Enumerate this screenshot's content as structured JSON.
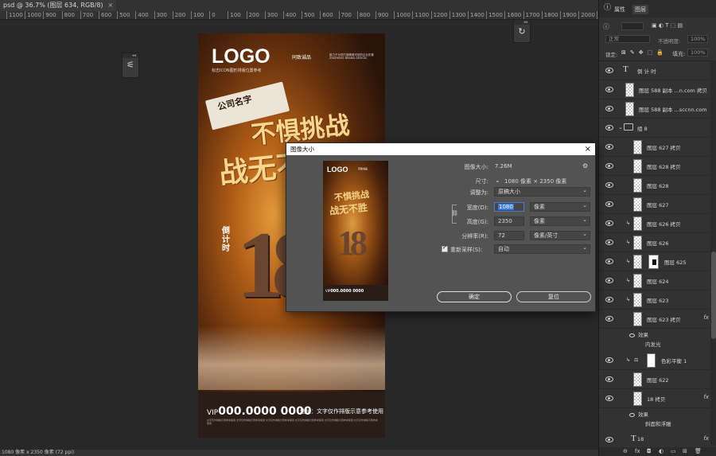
{
  "document_tab": {
    "title": "psd @ 36.7% (图层 634, RGB/8)",
    "close": "×"
  },
  "ruler_ticks": [
    "1100",
    "1000",
    "900",
    "800",
    "700",
    "600",
    "500",
    "400",
    "300",
    "200",
    "100",
    "0",
    "100",
    "200",
    "300",
    "400",
    "500",
    "600",
    "700",
    "800",
    "900",
    "1000",
    "1100",
    "1200",
    "1300",
    "1400",
    "1500",
    "1600",
    "1700",
    "1800",
    "1900",
    "2000",
    "2100"
  ],
  "status_bar": "1080 像素 x 2350 像素 (72 ppi)",
  "poster": {
    "logo": "LOGO",
    "logo_sub": "标志ICON图形排版位置参考",
    "brand": "同致诚品",
    "brand_small": "致力于为您打造精美可信的企业形象 ZHIZHENG BRAND DESIGN",
    "flag_text": "公司名字",
    "slogan_line1": "不惧挑战",
    "slogan_line2": "战无不胜",
    "countdown_label": "倒计时",
    "big_number": "18",
    "vip_prefix": "VIP",
    "vip_number": "000.0000 0000",
    "address": "地址：文字仅作排版示意参考使用",
    "fine_print": "文字仅作排版示意参考使用 文字仅作排版示意参考使用 文字仅作排版示意参考使用 文字仅作排版示意参考使用 文字仅作排版示意参考使用 文字仅作排版示意参考使用"
  },
  "panels": {
    "tabs": {
      "adjustments": "属性",
      "layers": "图层"
    },
    "blend_mode": "正常",
    "opacity_label": "不透明度:",
    "opacity_value": "100%",
    "lock_label": "锁定:",
    "fill_label": "填充:",
    "fill_value": "100%",
    "layers": [
      {
        "type": "text",
        "name": "倒 计 时"
      },
      {
        "type": "pixel",
        "name": "图层 588 副本 ...n.com 拷贝"
      },
      {
        "type": "pixel",
        "name": "图层 588 副本 ...sccnn.com"
      },
      {
        "type": "group",
        "name": "组 8"
      },
      {
        "type": "pixel",
        "name": "图层 627 拷贝"
      },
      {
        "type": "pixel",
        "name": "图层 628 拷贝"
      },
      {
        "type": "pixel",
        "name": "图层 628"
      },
      {
        "type": "pixel",
        "name": "图层 627"
      },
      {
        "type": "pixel",
        "name": "图层 626 拷贝"
      },
      {
        "type": "pixel",
        "name": "图层 626"
      },
      {
        "type": "masked",
        "name": "图层 625"
      },
      {
        "type": "pixel",
        "name": "图层 624"
      },
      {
        "type": "pixel",
        "name": "图层 623"
      },
      {
        "type": "pixel",
        "name": "图层 623 拷贝",
        "fx": "fx"
      },
      {
        "type": "adjust",
        "name": "色彩平衡 1"
      },
      {
        "type": "pixel",
        "name": "图层 622"
      },
      {
        "type": "pixel",
        "name": "18 拷贝",
        "fx": "fx"
      },
      {
        "type": "text",
        "name": "18",
        "fx": "fx"
      }
    ],
    "effects_label": "效果",
    "effect_inner_glow": "内发光",
    "effect_bevel": "斜面和浮雕",
    "bottom_icons": [
      "link-icon",
      "fx-icon",
      "mask-icon",
      "adjust-icon",
      "folder-icon",
      "new-layer-icon",
      "trash-icon"
    ],
    "bottom_glyphs": [
      "⊖",
      "fx",
      "◘",
      "◐",
      "▭",
      "⊞",
      "🗑"
    ]
  },
  "dialog": {
    "title": "图像大小",
    "close": "×",
    "image_size_label": "图像大小:",
    "image_size_value": "7.26M",
    "dimensions_label": "尺寸:",
    "dimensions_value": "1080 像素 × 2350 像素",
    "fit_to_label": "调整为:",
    "fit_to_value": "原稿大小",
    "width_label": "宽度(D):",
    "width_value": "1080",
    "width_unit": "像素",
    "height_label": "高度(G):",
    "height_value": "2350",
    "height_unit": "像素",
    "resolution_label": "分辨率(R):",
    "resolution_value": "72",
    "resolution_unit": "像素/英寸",
    "resample_label": "重新采样(S):",
    "resample_value": "自动",
    "ok": "确定",
    "reset": "复位",
    "preview": {
      "logo": "LOGO",
      "brand": "同致诚品",
      "s1": "不惧挑战",
      "s2": "战无不胜",
      "num": "18",
      "vip_prefix": "VIP",
      "vip_number": "000.0000 0000"
    }
  }
}
